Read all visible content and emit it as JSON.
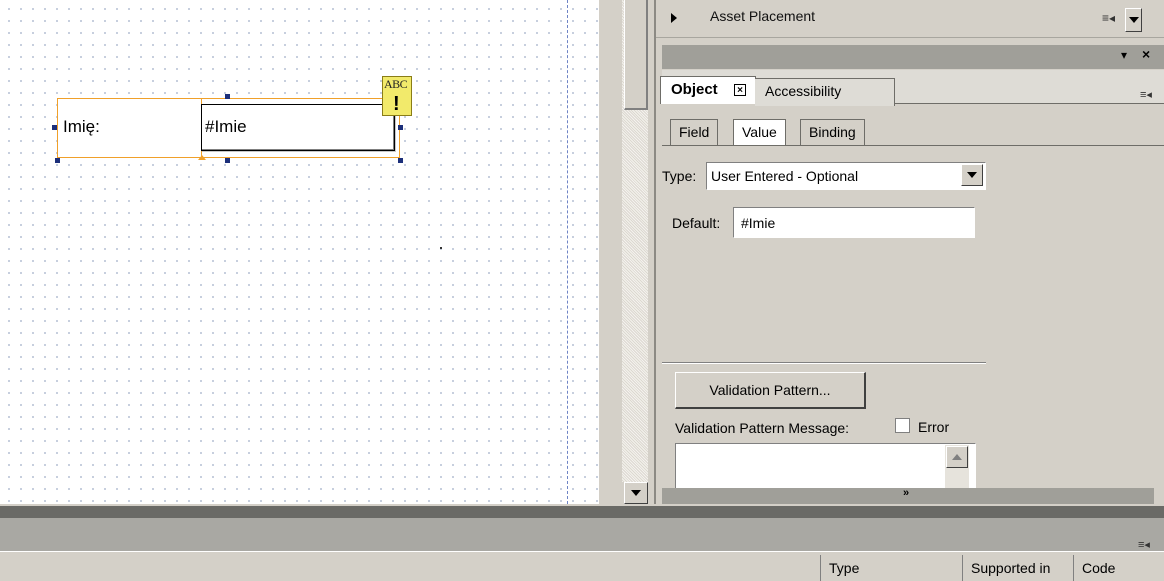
{
  "canvas": {
    "label": "Imię:",
    "field_value": "#Imie"
  },
  "right_panel": {
    "asset_placement": "Asset Placement",
    "tabs": [
      "Object",
      "Accessibility"
    ],
    "subtabs": [
      "Field",
      "Value",
      "Binding"
    ],
    "type_label": "Type:",
    "type_value": "User Entered - Optional",
    "default_label": "Default:",
    "default_value": "#Imie",
    "validation_button": "Validation Pattern...",
    "validation_message_label": "Validation Pattern Message:",
    "error_label": "Error"
  },
  "bottom_panel": {
    "columns": [
      "Type",
      "Supported in",
      "Code"
    ]
  },
  "colors": {
    "selection": "#f0a02a",
    "handle": "#1c2f7a",
    "panel": "#d4d0c8"
  }
}
